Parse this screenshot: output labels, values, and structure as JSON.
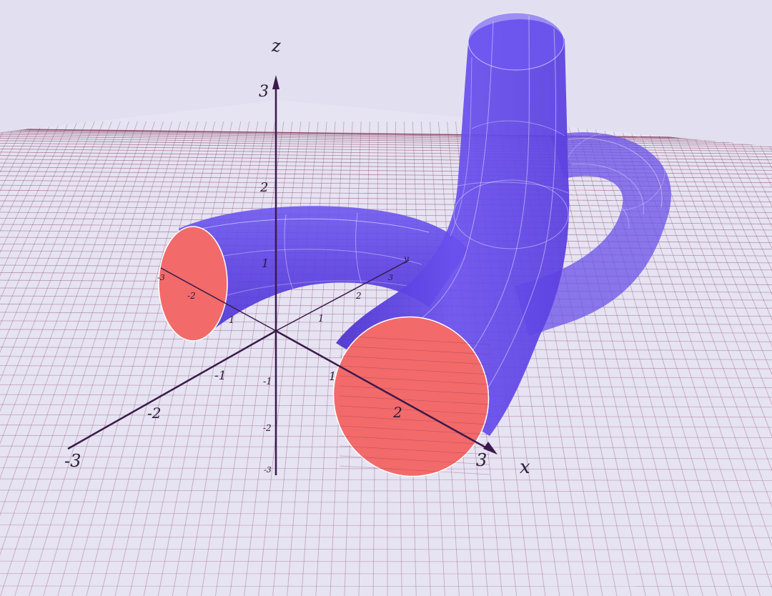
{
  "axes": {
    "x_label": "x",
    "y_label": "y",
    "z_label": "z"
  },
  "x_ticks": [
    "-3",
    "-2",
    "-1",
    "1",
    "2",
    "3"
  ],
  "y_ticks": [
    "-3",
    "-2",
    "1",
    "2",
    "3"
  ],
  "y_ticks_right": [
    "1",
    "2",
    "3"
  ],
  "z_ticks": [
    "3",
    "2",
    "1",
    "-1",
    "-2",
    "-3"
  ],
  "colors": {
    "background": "#e2e0f0",
    "grid": "#7a3050",
    "tube": "#5a3fe0",
    "tube_cap": "#f26a6a",
    "axis": "#3a1a4a"
  }
}
